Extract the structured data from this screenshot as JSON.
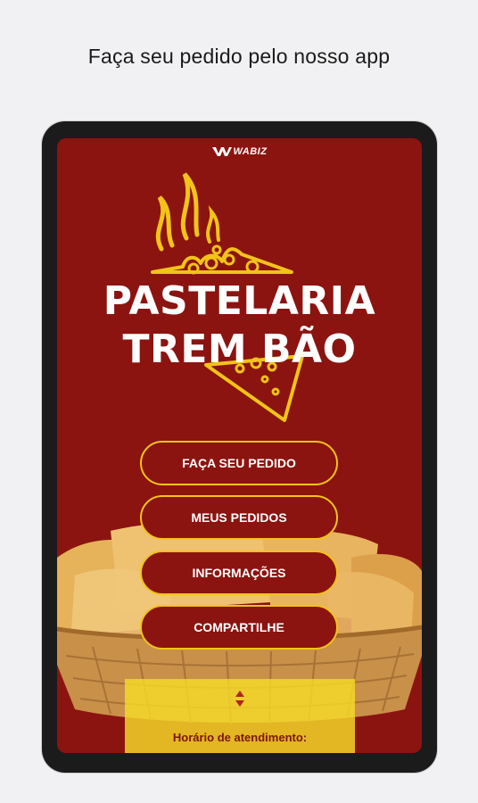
{
  "caption": "Faça seu pedido pelo nosso app",
  "brand": {
    "name": "WABIZ"
  },
  "logo": {
    "line1": "PASTELARIA",
    "line2": "TREM BÃO"
  },
  "menu": [
    {
      "label": "FAÇA SEU PEDIDO"
    },
    {
      "label": "MEUS PEDIDOS"
    },
    {
      "label": "INFORMAÇÕES"
    },
    {
      "label": "COMPARTILHE"
    }
  ],
  "hours": {
    "label": "Horário de atendimento:"
  },
  "colors": {
    "background": "#8b1410",
    "accent": "#f2c318",
    "hours_panel": "#f6da28"
  }
}
